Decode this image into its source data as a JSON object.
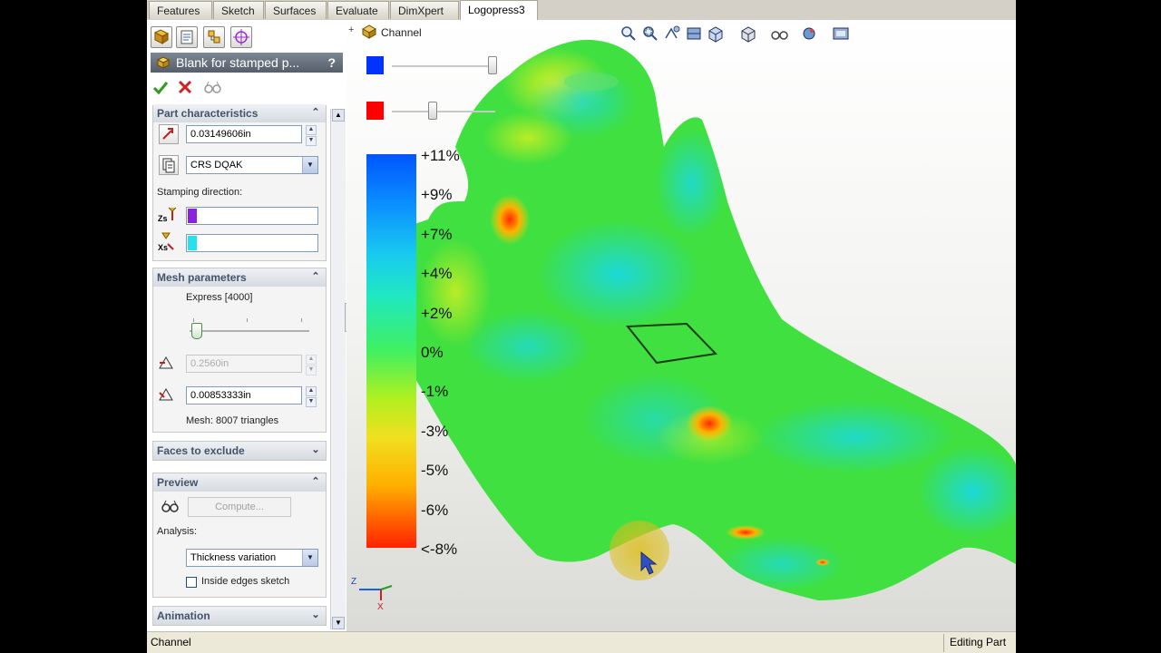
{
  "tabs": [
    "Features",
    "Sketch",
    "Surfaces",
    "Evaluate",
    "DimXpert",
    "Logopress3"
  ],
  "active_tab": "Logopress3",
  "feature_tree": {
    "root_label": "Channel"
  },
  "property_manager": {
    "title": "Blank for stamped p...",
    "help": "?",
    "part_characteristics": {
      "header": "Part characteristics",
      "thickness_value": "0.03149606in",
      "material_value": "CRS DQAK",
      "stamping_direction_label": "Stamping direction:"
    },
    "mesh_parameters": {
      "header": "Mesh parameters",
      "quality_label": "Express [4000]",
      "max_element_value": "0.2560in",
      "min_element_value": "0.00853333in",
      "mesh_info": "Mesh: 8007 triangles"
    },
    "faces_to_exclude": {
      "header": "Faces to exclude"
    },
    "preview": {
      "header": "Preview",
      "compute_label": "Compute...",
      "analysis_label": "Analysis:",
      "analysis_value": "Thickness variation",
      "inside_edges_label": "Inside edges sketch"
    },
    "animation": {
      "header": "Animation"
    }
  },
  "legend": {
    "labels": [
      "+11%",
      "+9%",
      "+7%",
      "+4%",
      "+2%",
      "0%",
      "-1%",
      "-3%",
      "-5%",
      "-6%",
      "<-8%"
    ],
    "top_color": "#0055ff",
    "bottom_color": "#ff2200",
    "blue_swatch": "#0033ff",
    "red_swatch": "#ff0000"
  },
  "triad": {
    "z_label": "Z",
    "x_label": "X"
  },
  "status_bar": {
    "left": "Channel",
    "right": "Editing Part"
  }
}
